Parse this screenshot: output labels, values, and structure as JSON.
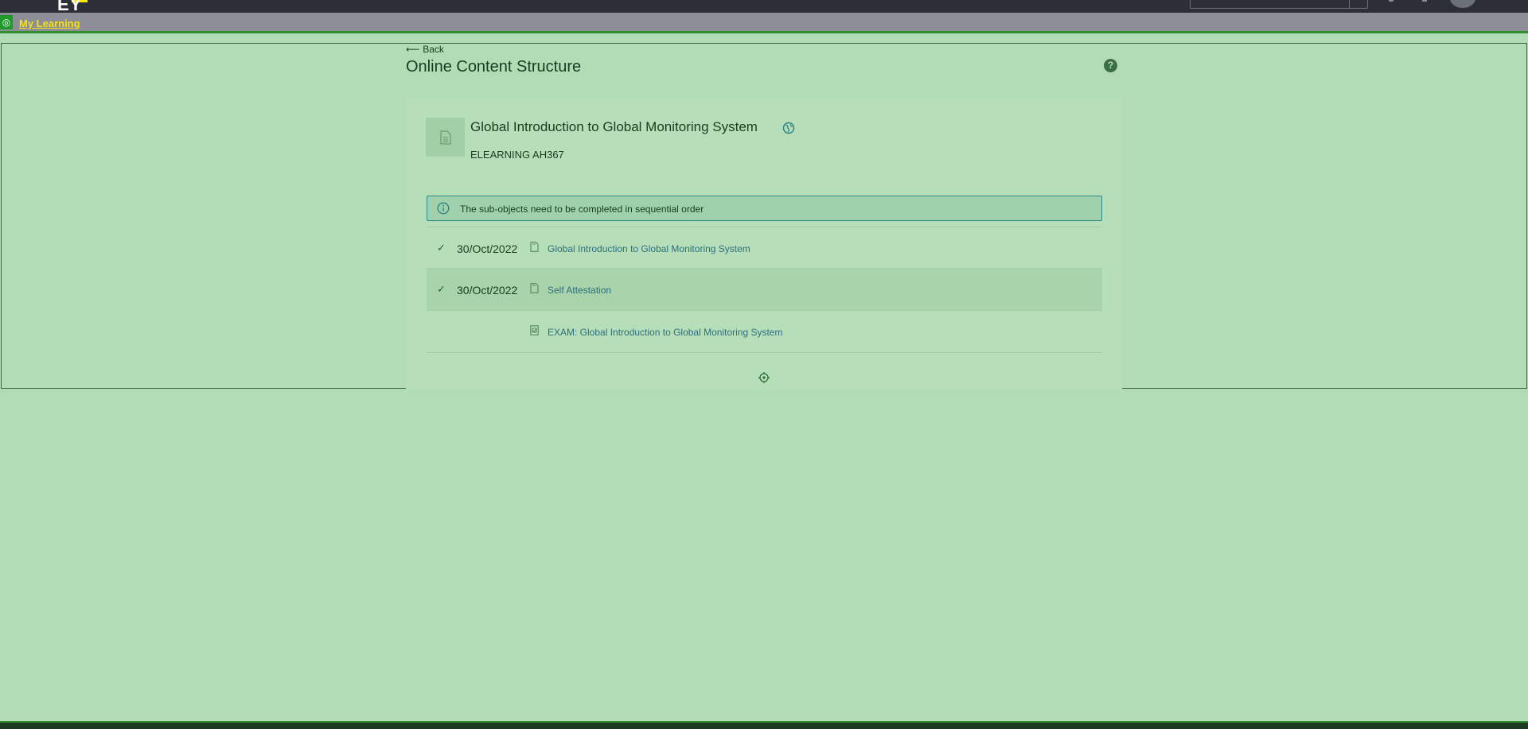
{
  "header": {
    "logo_text": "EY"
  },
  "toolbar": {
    "link_label": "My Learning"
  },
  "page": {
    "back_label": "Back",
    "title": "Online Content Structure",
    "help_symbol": "?"
  },
  "course": {
    "title": "Global Introduction to Global Monitoring System",
    "code": "ELEARNING AH367"
  },
  "info_banner": {
    "text": "The sub-objects need to be completed in sequential order"
  },
  "sub_objects": [
    {
      "completed": true,
      "date": "30/Oct/2022",
      "label": "Global Introduction to Global Monitoring System",
      "icon": "document-icon"
    },
    {
      "completed": true,
      "date": "30/Oct/2022",
      "label": "Self Attestation",
      "icon": "document-icon"
    },
    {
      "completed": false,
      "date": "",
      "label": "EXAM: Global Introduction to Global Monitoring System",
      "icon": "exam-icon"
    }
  ],
  "colors": {
    "accent": "#2d8b89",
    "link": "#2e6f7d",
    "toolbar_link": "#f5e11a",
    "overlay": "#b2dcb5"
  }
}
